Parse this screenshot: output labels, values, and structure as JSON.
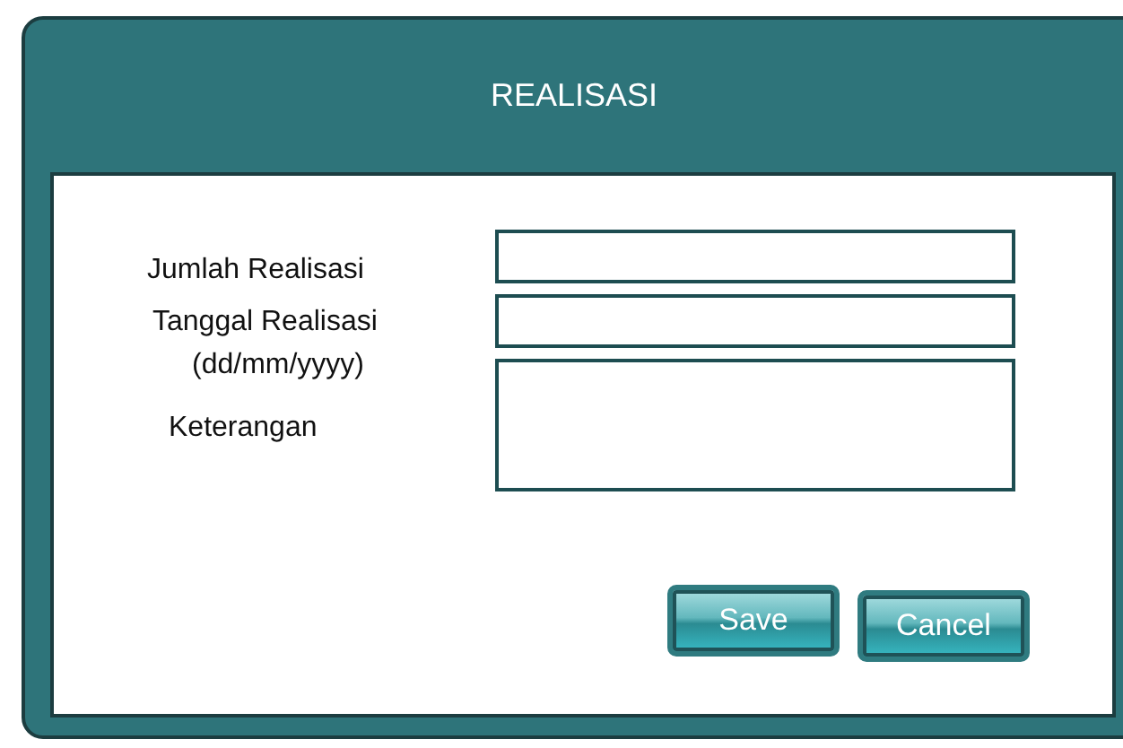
{
  "dialog": {
    "title": "REALISASI"
  },
  "fields": [
    {
      "label": "Jumlah Realisasi",
      "kind": "line"
    },
    {
      "label": "Tanggal Realisasi",
      "hint": "(dd/mm/yyyy)",
      "kind": "line"
    },
    {
      "label": "Keterangan",
      "kind": "area"
    }
  ],
  "buttons": [
    "Save",
    "Cancel"
  ]
}
